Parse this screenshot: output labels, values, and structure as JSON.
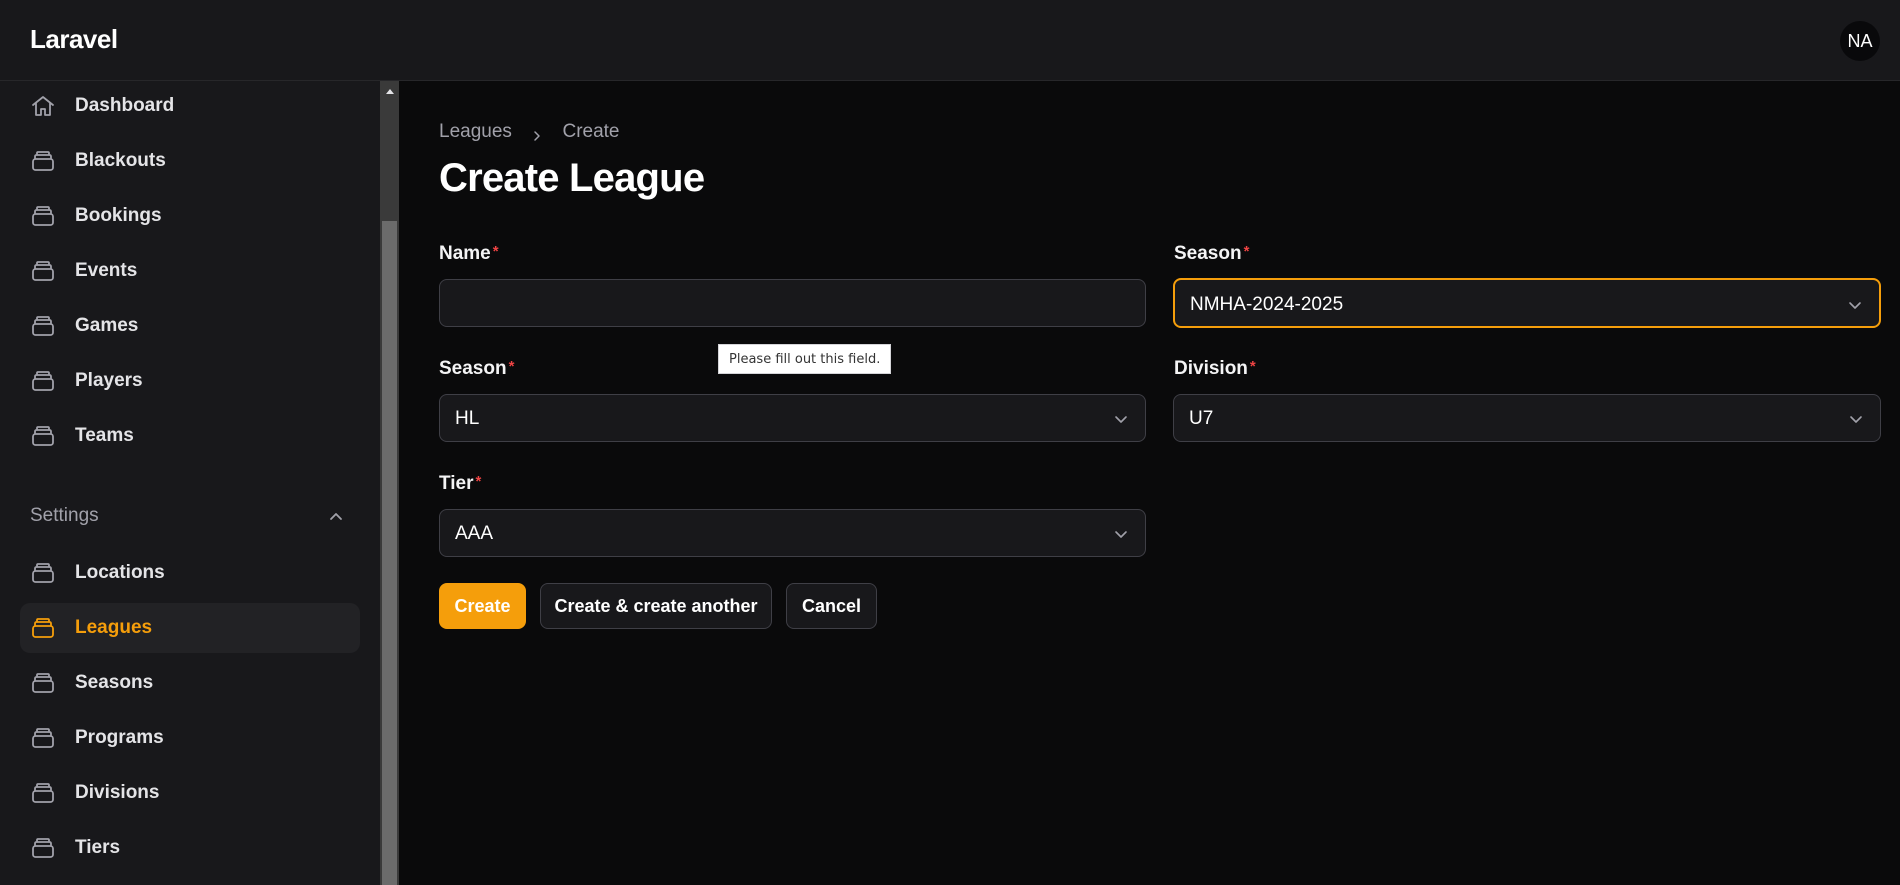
{
  "app": {
    "brand": "Laravel",
    "user_initials": "NA"
  },
  "sidebar": {
    "items": [
      {
        "label": "Dashboard",
        "icon": "home-icon"
      },
      {
        "label": "Blackouts",
        "icon": "stack-icon"
      },
      {
        "label": "Bookings",
        "icon": "stack-icon"
      },
      {
        "label": "Events",
        "icon": "stack-icon"
      },
      {
        "label": "Games",
        "icon": "stack-icon"
      },
      {
        "label": "Players",
        "icon": "stack-icon"
      },
      {
        "label": "Teams",
        "icon": "stack-icon"
      }
    ],
    "settings_group": {
      "label": "Settings",
      "items": [
        {
          "label": "Locations",
          "icon": "stack-icon"
        },
        {
          "label": "Leagues",
          "icon": "stack-icon",
          "active": true
        },
        {
          "label": "Seasons",
          "icon": "stack-icon"
        },
        {
          "label": "Programs",
          "icon": "stack-icon"
        },
        {
          "label": "Divisions",
          "icon": "stack-icon"
        },
        {
          "label": "Tiers",
          "icon": "stack-icon"
        }
      ]
    }
  },
  "breadcrumb": {
    "parent": "Leagues",
    "current": "Create"
  },
  "page": {
    "title": "Create League"
  },
  "form": {
    "name": {
      "label": "Name",
      "required_mark": "*",
      "value": ""
    },
    "season_right": {
      "label": "Season",
      "required_mark": "*",
      "value": "NMHA-2024-2025"
    },
    "season_left": {
      "label": "Season",
      "required_mark": "*",
      "value": "HL"
    },
    "division": {
      "label": "Division",
      "required_mark": "*",
      "value": "U7"
    },
    "tier": {
      "label": "Tier",
      "required_mark": "*",
      "value": "AAA"
    },
    "validation_tooltip": "Please fill out this field."
  },
  "actions": {
    "create": "Create",
    "create_another": "Create & create another",
    "cancel": "Cancel"
  },
  "colors": {
    "accent": "#f59e0b",
    "required": "#ef4444",
    "background": "#0a0a0b",
    "surface": "#18181b"
  }
}
